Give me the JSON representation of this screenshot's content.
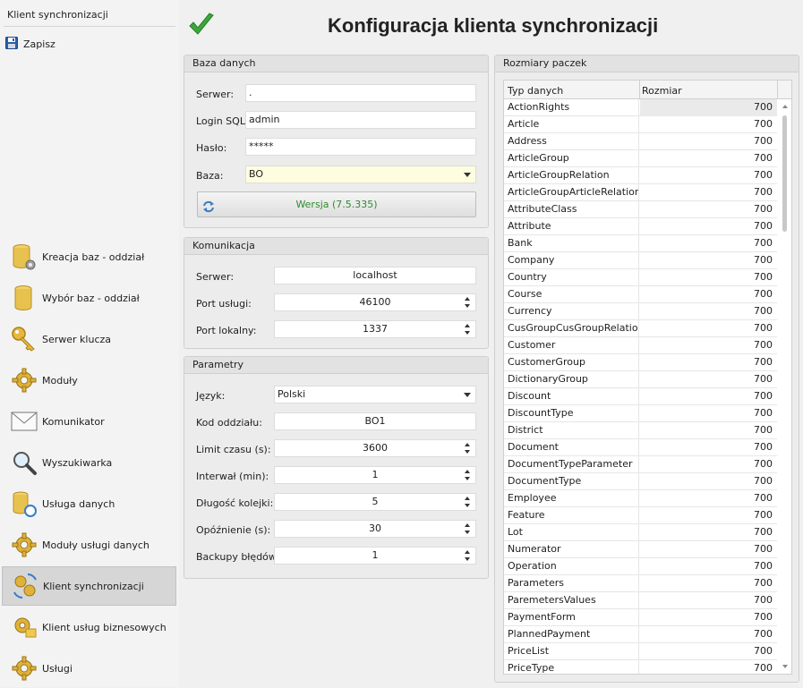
{
  "sidebar": {
    "title": "Klient synchronizacji",
    "save_label": "Zapisz",
    "items": [
      {
        "label": "Kreacja baz - oddział",
        "icon": "db-gear-icon"
      },
      {
        "label": "Wybór baz - oddział",
        "icon": "db-icon"
      },
      {
        "label": "Serwer klucza",
        "icon": "key-icon"
      },
      {
        "label": "Moduły",
        "icon": "gear-icon"
      },
      {
        "label": "Komunikator",
        "icon": "envelope-icon"
      },
      {
        "label": "Wyszukiwarka",
        "icon": "magnifier-icon"
      },
      {
        "label": "Usługa danych",
        "icon": "db-sync-icon"
      },
      {
        "label": "Moduły usługi danych",
        "icon": "gear-icon"
      },
      {
        "label": "Klient synchronizacji",
        "icon": "sync-gears-icon",
        "active": true
      },
      {
        "label": "Klient usług biznesowych",
        "icon": "gear-folder-icon"
      },
      {
        "label": "Usługi",
        "icon": "gear-icon"
      }
    ]
  },
  "header": {
    "title": "Konfiguracja klienta synchronizacji"
  },
  "db": {
    "title": "Baza danych",
    "server_label": "Serwer:",
    "server_value": ".",
    "login_label": "Login SQL:",
    "login_value": "admin",
    "password_label": "Hasło:",
    "password_value": "*****",
    "base_label": "Baza:",
    "base_value": "BO",
    "version_button": "Wersja (7.5.335)"
  },
  "comm": {
    "title": "Komunikacja",
    "server_label": "Serwer:",
    "server_value": "localhost",
    "port_service_label": "Port usługi:",
    "port_service_value": "46100",
    "port_local_label": "Port lokalny:",
    "port_local_value": "1337"
  },
  "params": {
    "title": "Parametry",
    "language_label": "Język:",
    "language_value": "Polski",
    "branch_code_label": "Kod oddziału:",
    "branch_code_value": "BO1",
    "time_limit_label": "Limit czasu (s):",
    "time_limit_value": "3600",
    "interval_label": "Interwał (min):",
    "interval_value": "1",
    "queue_label": "Długość kolejki:",
    "queue_value": "5",
    "delay_label": "Opóźnienie (s):",
    "delay_value": "30",
    "backup_label": "Backupy błędów:",
    "backup_value": "1"
  },
  "packets": {
    "title": "Rozmiary paczek",
    "col_type": "Typ danych",
    "col_size": "Rozmiar",
    "rows": [
      {
        "type": "ActionRights",
        "size": "700"
      },
      {
        "type": "Article",
        "size": "700"
      },
      {
        "type": "Address",
        "size": "700"
      },
      {
        "type": "ArticleGroup",
        "size": "700"
      },
      {
        "type": "ArticleGroupRelation",
        "size": "700"
      },
      {
        "type": "ArticleGroupArticleRelation",
        "size": "700"
      },
      {
        "type": "AttributeClass",
        "size": "700"
      },
      {
        "type": "Attribute",
        "size": "700"
      },
      {
        "type": "Bank",
        "size": "700"
      },
      {
        "type": "Company",
        "size": "700"
      },
      {
        "type": "Country",
        "size": "700"
      },
      {
        "type": "Course",
        "size": "700"
      },
      {
        "type": "Currency",
        "size": "700"
      },
      {
        "type": "CusGroupCusGroupRelation",
        "size": "700"
      },
      {
        "type": "Customer",
        "size": "700"
      },
      {
        "type": "CustomerGroup",
        "size": "700"
      },
      {
        "type": "DictionaryGroup",
        "size": "700"
      },
      {
        "type": "Discount",
        "size": "700"
      },
      {
        "type": "DiscountType",
        "size": "700"
      },
      {
        "type": "District",
        "size": "700"
      },
      {
        "type": "Document",
        "size": "700"
      },
      {
        "type": "DocumentTypeParameter",
        "size": "700"
      },
      {
        "type": "DocumentType",
        "size": "700"
      },
      {
        "type": "Employee",
        "size": "700"
      },
      {
        "type": "Feature",
        "size": "700"
      },
      {
        "type": "Lot",
        "size": "700"
      },
      {
        "type": "Numerator",
        "size": "700"
      },
      {
        "type": "Operation",
        "size": "700"
      },
      {
        "type": "Parameters",
        "size": "700"
      },
      {
        "type": "ParemetersValues",
        "size": "700"
      },
      {
        "type": "PaymentForm",
        "size": "700"
      },
      {
        "type": "PlannedPayment",
        "size": "700"
      },
      {
        "type": "PriceList",
        "size": "700"
      },
      {
        "type": "PriceType",
        "size": "700"
      }
    ]
  }
}
